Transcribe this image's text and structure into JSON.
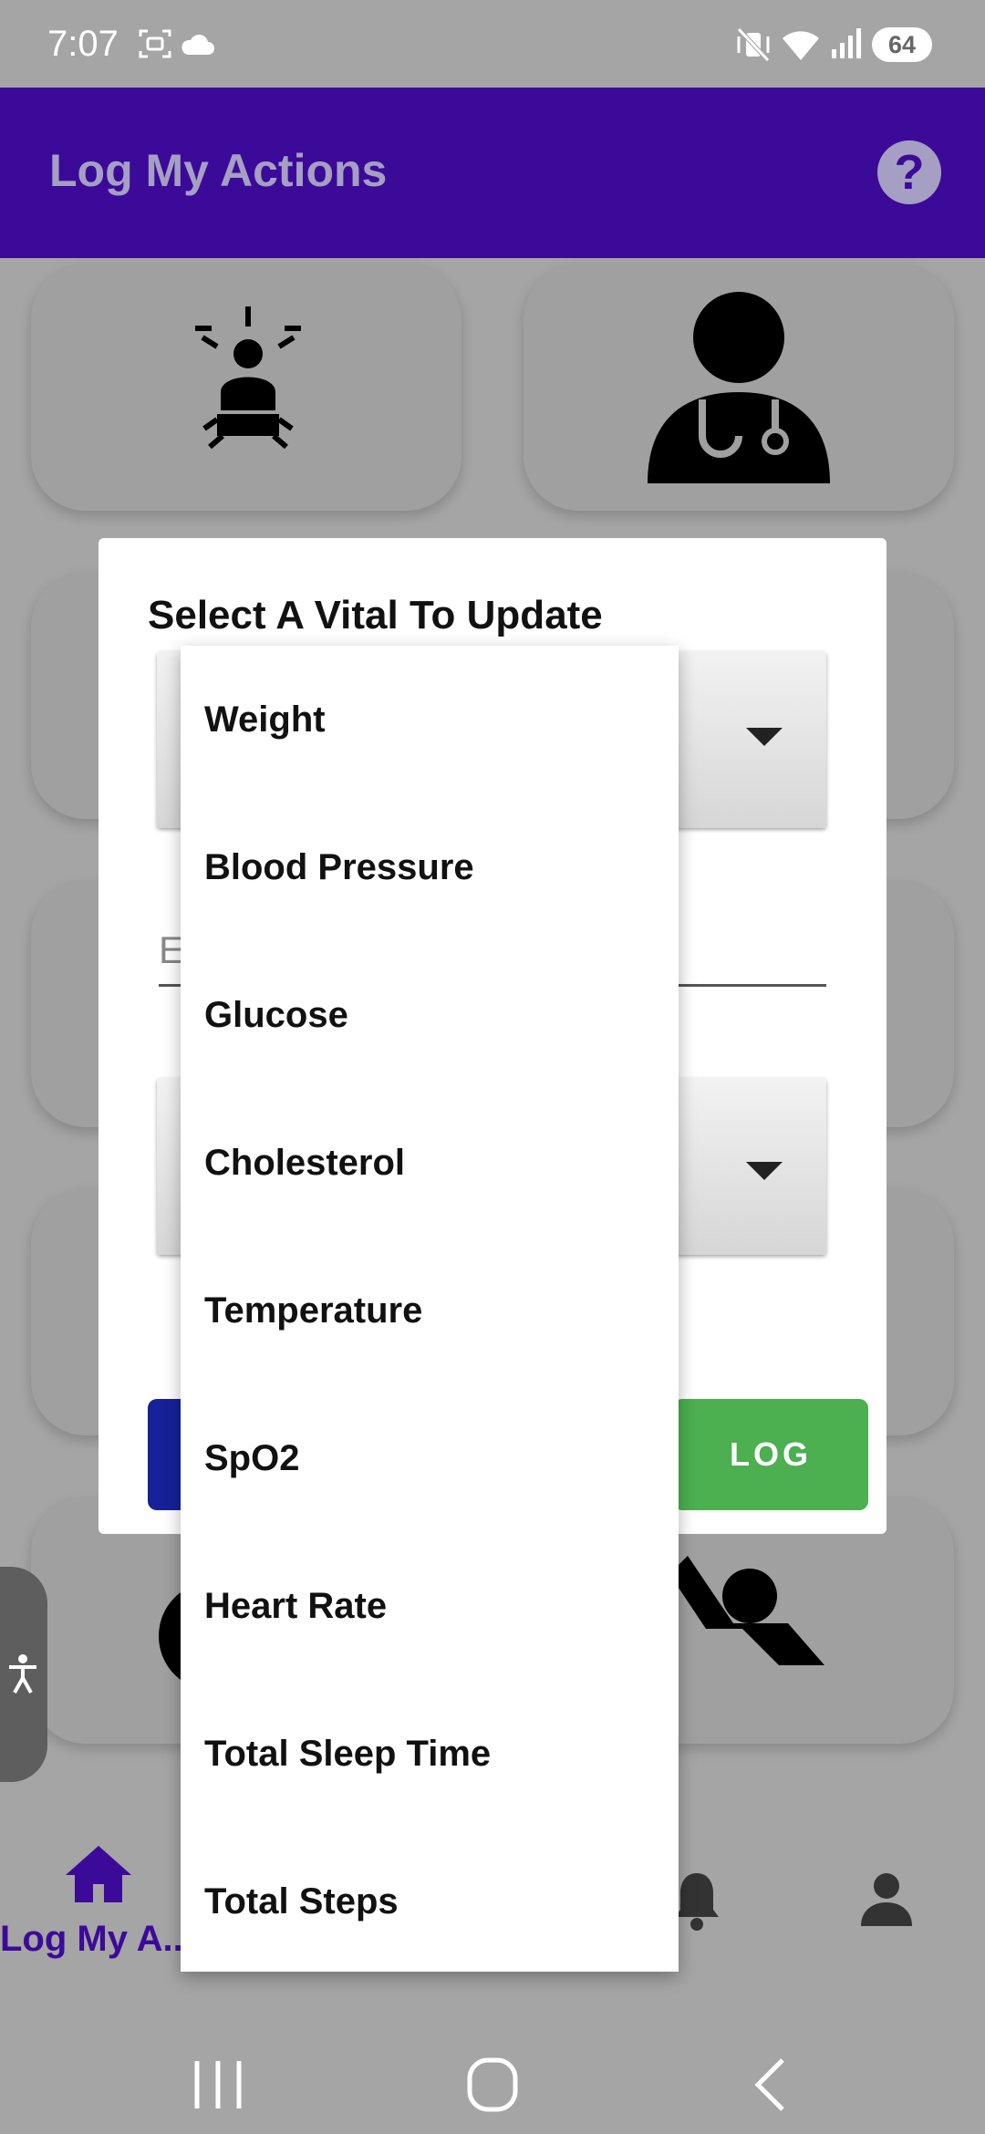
{
  "status_bar": {
    "time": "7:07",
    "battery": "64"
  },
  "app_bar": {
    "title": "Log My Actions",
    "help_icon": "help-circle-icon"
  },
  "colors": {
    "primary": "#3c0a99",
    "log_button": "#4caf50",
    "cancel_button": "#16219a",
    "scrim": "#a5a5a5"
  },
  "dialog": {
    "title": "Select A Vital To Update",
    "value_placeholder": "E",
    "log_button": "LOG"
  },
  "dropdown": {
    "options": [
      "Weight",
      "Blood Pressure",
      "Glucose",
      "Cholesterol",
      "Temperature",
      "SpO2",
      "Heart Rate",
      "Total Sleep Time",
      "Total Steps"
    ]
  },
  "bottom_nav": {
    "home_label": "Log My A..."
  }
}
